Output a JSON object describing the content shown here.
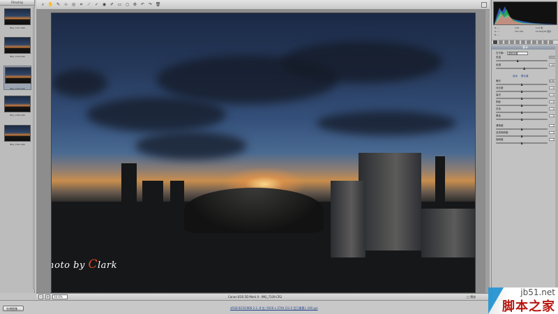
{
  "filmstrip": {
    "title": "Filmstrip",
    "items": [
      {
        "label": "IMG_7317.CR2",
        "selected": false
      },
      {
        "label": "IMG_7319.CR2",
        "selected": false
      },
      {
        "label": "IMG_7339.CR2",
        "selected": true,
        "stars": "· · · · ·"
      },
      {
        "label": "IMG_7340.CR2",
        "selected": false
      },
      {
        "label": "IMG_7341.CR2",
        "selected": false
      }
    ]
  },
  "toolbar": {
    "tools": [
      "zoom-icon",
      "hand-icon",
      "white-balance-icon",
      "color-sampler-icon",
      "target-adjust-icon",
      "crop-icon",
      "straighten-icon",
      "spot-removal-icon",
      "red-eye-icon",
      "adjust-brush-icon",
      "graduated-filter-icon",
      "radial-filter-icon",
      "preferences-icon",
      "rotate-left-icon",
      "rotate-right-icon",
      "trash-icon"
    ],
    "glyphs": [
      "⌕",
      "✋",
      "✎",
      "⊹",
      "◎",
      "⌗",
      "⟋",
      "✓",
      "◉",
      "✐",
      "▭",
      "○",
      "⚙",
      "↶",
      "↷",
      "🗑"
    ]
  },
  "photo": {
    "watermark_prefix": "Photo by ",
    "watermark_initial": "C",
    "watermark_rest": "lark"
  },
  "statusbar": {
    "zoom_minus": "−",
    "zoom_plus": "+",
    "zoom_value": "16.6%",
    "filename": "Canon EOS 5D Mark II - IMG_7339.CR2",
    "right_label": "□ 预览"
  },
  "bottombar": {
    "save_label": "存储图像...",
    "workflow_link": "sRGB IEC61966-2.1; 8 位; 5616 x 3744 (21.0 百万像素); 240 ppi"
  },
  "right_panel": {
    "exif": [
      [
        "R: ---",
        "f/16",
        "1/13 秒"
      ],
      [
        "G: ---",
        "ISO 100",
        "16-35@16 毫米"
      ],
      [
        "B: ---",
        "",
        ""
      ]
    ],
    "section_title": "基本",
    "white_balance_label": "白平衡:",
    "white_balance_value": "原照设置",
    "sliders_top": [
      {
        "label": "色温",
        "value": "4900",
        "pos": 0.42
      },
      {
        "label": "色调",
        "value": "+5",
        "pos": 0.55
      }
    ],
    "auto_label": "自动",
    "default_label": "默认值",
    "sliders_tone": [
      {
        "label": "曝光",
        "value": "0.00",
        "pos": 0.5
      },
      {
        "label": "对比度",
        "value": "0",
        "pos": 0.5
      },
      {
        "label": "高光",
        "value": "0",
        "pos": 0.5
      },
      {
        "label": "阴影",
        "value": "0",
        "pos": 0.5
      },
      {
        "label": "白色",
        "value": "0",
        "pos": 0.5
      },
      {
        "label": "黑色",
        "value": "0",
        "pos": 0.5
      }
    ],
    "sliders_presence": [
      {
        "label": "清晰度",
        "value": "0",
        "pos": 0.5
      },
      {
        "label": "自然饱和度",
        "value": "0",
        "pos": 0.5
      },
      {
        "label": "饱和度",
        "value": "0",
        "pos": 0.5
      }
    ]
  },
  "logo": {
    "url": "jb51.net",
    "cn": "脚本之家"
  }
}
